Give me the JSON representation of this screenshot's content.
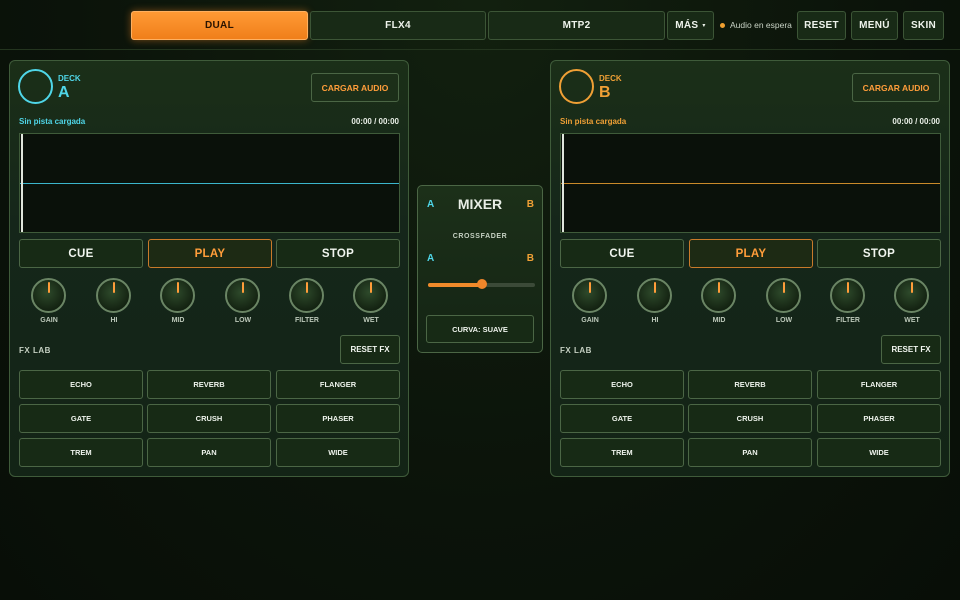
{
  "colors": {
    "accent": "#f08a2a",
    "deck_a": "#4fd6e8",
    "deck_b": "#f0a035"
  },
  "topbar": {
    "tabs": [
      {
        "label": "DUAL",
        "active": true
      },
      {
        "label": "FLX4",
        "active": false
      },
      {
        "label": "MTP2",
        "active": false
      }
    ],
    "more_label": "MÁS",
    "more_icon": "chevron-down-icon",
    "status_text": "Audio en espera",
    "reset_label": "RESET",
    "menu_label": "MENÚ",
    "skin_label": "SKIN"
  },
  "decks": [
    {
      "label": "DECK",
      "letter": "A",
      "load_label": "CARGAR AUDIO",
      "track_name": "Sin pista cargada",
      "time": "00:00 / 00:00",
      "transport": [
        "CUE",
        "PLAY",
        "STOP"
      ],
      "knobs": [
        "GAIN",
        "HI",
        "MID",
        "LOW",
        "FILTER",
        "WET"
      ],
      "fx_title": "FX LAB",
      "fx_reset": "RESET FX",
      "fx": [
        "ECHO",
        "REVERB",
        "FLANGER",
        "GATE",
        "CRUSH",
        "PHASER",
        "TREM",
        "PAN",
        "WIDE"
      ]
    },
    {
      "label": "DECK",
      "letter": "B",
      "load_label": "CARGAR AUDIO",
      "track_name": "Sin pista cargada",
      "time": "00:00 / 00:00",
      "transport": [
        "CUE",
        "PLAY",
        "STOP"
      ],
      "knobs": [
        "GAIN",
        "HI",
        "MID",
        "LOW",
        "FILTER",
        "WET"
      ],
      "fx_title": "FX LAB",
      "fx_reset": "RESET FX",
      "fx": [
        "ECHO",
        "REVERB",
        "FLANGER",
        "GATE",
        "CRUSH",
        "PHASER",
        "TREM",
        "PAN",
        "WIDE"
      ]
    }
  ],
  "mixer": {
    "title": "MIXER",
    "left": "A",
    "right": "B",
    "crossfader_label": "CROSSFADER",
    "crossfader_value": 0.5,
    "curve_label": "CURVA: SUAVE"
  }
}
